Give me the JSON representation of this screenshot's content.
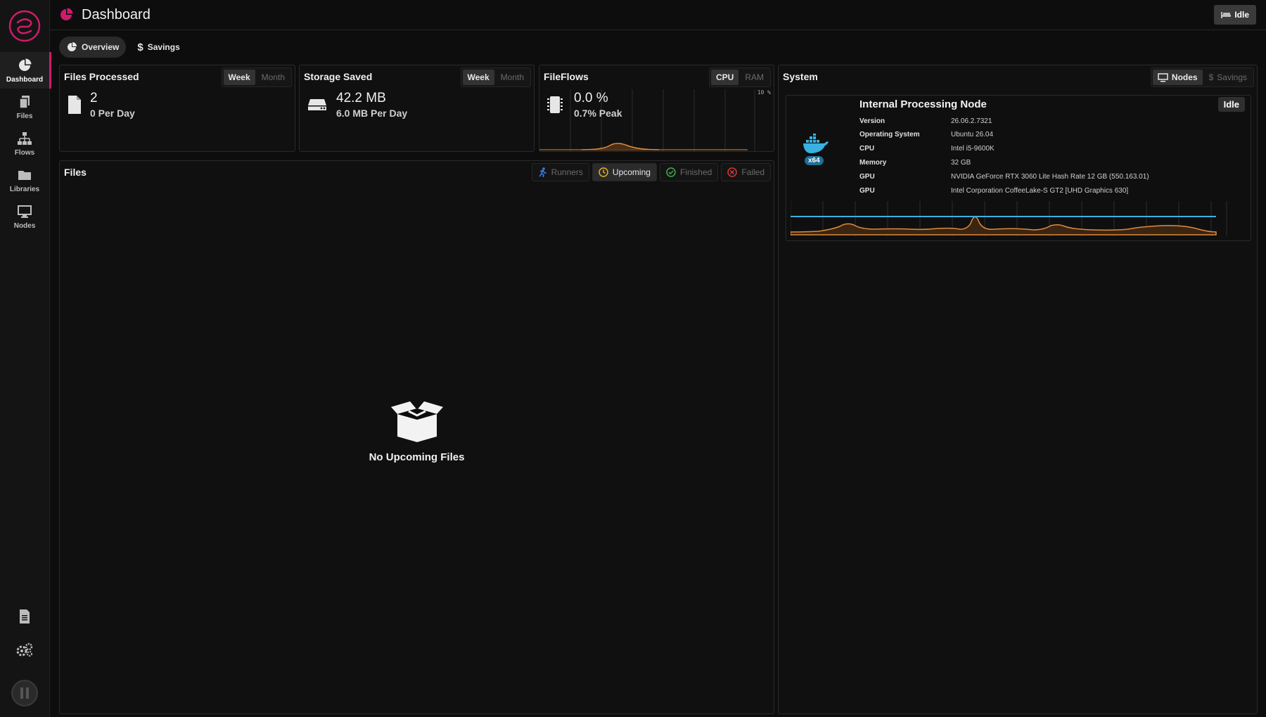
{
  "app": {
    "title": "Dashboard"
  },
  "header": {
    "status_label": "Idle"
  },
  "sidebar": {
    "items": [
      {
        "label": "Dashboard"
      },
      {
        "label": "Files"
      },
      {
        "label": "Flows"
      },
      {
        "label": "Libraries"
      },
      {
        "label": "Nodes"
      }
    ]
  },
  "subtabs": [
    {
      "label": "Overview"
    },
    {
      "label": "Savings"
    }
  ],
  "files_processed": {
    "title": "Files Processed",
    "toggles": [
      "Week",
      "Month"
    ],
    "value": "2",
    "per_day": "0 Per Day"
  },
  "storage_saved": {
    "title": "Storage Saved",
    "toggles": [
      "Week",
      "Month"
    ],
    "value": "42.2 MB",
    "per_day": "6.0 MB Per Day"
  },
  "fileflows": {
    "title": "FileFlows",
    "toggles": [
      "CPU",
      "RAM"
    ],
    "value": "0.0 %",
    "peak": "0.7% Peak",
    "axis_label": "10 %"
  },
  "files": {
    "title": "Files",
    "tabs": [
      "Runners",
      "Upcoming",
      "Finished",
      "Failed"
    ],
    "empty_label": "No Upcoming Files"
  },
  "system": {
    "title": "System",
    "toggles": [
      "Nodes",
      "Savings"
    ],
    "node": {
      "name": "Internal Processing Node",
      "status": "Idle",
      "arch": "x64",
      "info": [
        {
          "key": "Version",
          "value": "26.06.2.7321"
        },
        {
          "key": "Operating System",
          "value": "Ubuntu 26.04"
        },
        {
          "key": "CPU",
          "value": "Intel i5-9600K"
        },
        {
          "key": "Memory",
          "value": "32 GB"
        },
        {
          "key": "GPU",
          "value": "NVIDIA GeForce RTX 3060 Lite Hash Rate 12 GB (550.163.01)"
        },
        {
          "key": "GPU",
          "value": "Intel Corporation CoffeeLake-S GT2 [UHD Graphics 630]"
        }
      ]
    }
  },
  "colors": {
    "accent": "#d01a6b",
    "cpu_line": "#e08a3c",
    "ram_line": "#3ab0e0"
  }
}
